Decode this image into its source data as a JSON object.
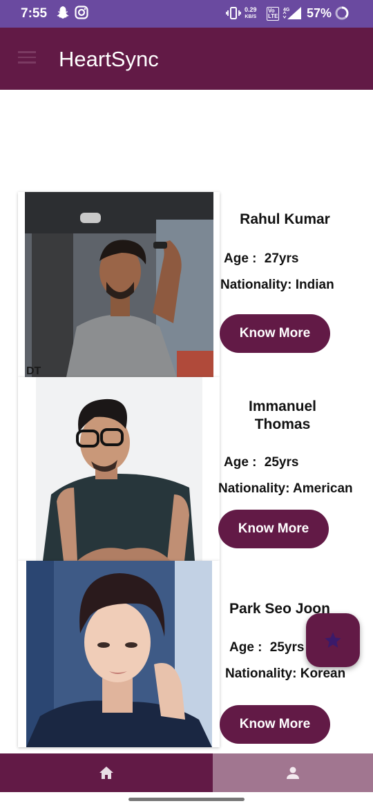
{
  "status_bar": {
    "time": "7:55",
    "net_speed_value": "0.29",
    "net_speed_unit": "KB/S",
    "volte": "Vo LTE",
    "network_type": "4G",
    "battery": "57%"
  },
  "app_bar": {
    "title": "HeartSync"
  },
  "profiles": [
    {
      "name": "Rahul Kumar",
      "age_label": "Age :",
      "age": "27yrs",
      "nationality_label": "Nationality:",
      "nationality": "Indian",
      "button": "Know More"
    },
    {
      "name": "Immanuel Thomas",
      "age_label": "Age :",
      "age": "25yrs",
      "nationality_label": "Nationality:",
      "nationality": "American",
      "button": "Know More"
    },
    {
      "name": "Park Seo Joon",
      "age_label": "Age :",
      "age": "25yrs",
      "nationality_label": "Nationality:",
      "nationality": "Korean",
      "button": "Know More"
    }
  ],
  "fab": {
    "icon": "star-icon"
  },
  "bottom_nav": {
    "items": [
      {
        "icon": "home-icon"
      },
      {
        "icon": "person-icon"
      }
    ]
  },
  "colors": {
    "primary": "#621a46",
    "status_bar": "#6a4aa0",
    "nav_inactive": "#a17690"
  }
}
